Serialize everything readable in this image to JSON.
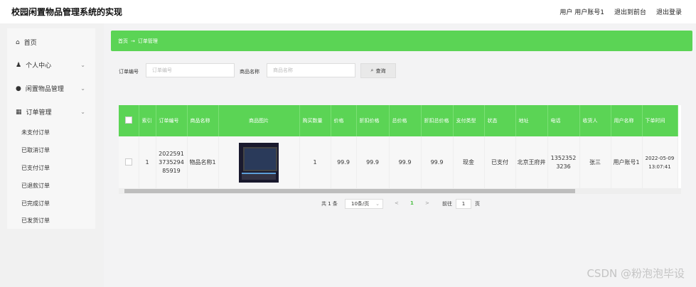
{
  "header": {
    "app_title": "校园闲置物品管理系统的实现",
    "user_label": "用户 用户账号1",
    "back_front": "退出到前台",
    "logout": "退出登录"
  },
  "sidebar": {
    "home": "首页",
    "personal_center": "个人中心",
    "idle_goods": "闲置物品管理",
    "order_mgmt": "订单管理",
    "sub_items": [
      "未支付订单",
      "已取消订单",
      "已支付订单",
      "已退款订单",
      "已完成订单",
      "已发货订单"
    ]
  },
  "breadcrumb": {
    "home": "首页",
    "arrow": "→",
    "current": "订单管理"
  },
  "search": {
    "order_no_label": "订单编号",
    "order_no_placeholder": "订单编号",
    "goods_name_label": "商品名称",
    "goods_name_placeholder": "商品名称",
    "query_button": "查询"
  },
  "table": {
    "headers": [
      "索引",
      "订单编号",
      "商品名称",
      "商品图片",
      "购买数量",
      "价格",
      "折扣价格",
      "总价格",
      "折扣总价格",
      "支付类型",
      "状态",
      "地址",
      "电话",
      "收货人",
      "用户名称",
      "下单时间"
    ],
    "rows": [
      {
        "index": "1",
        "order_no": "2022591373529485919",
        "goods_name": "物品名称1",
        "quantity": "1",
        "price": "99.9",
        "discount_price": "99.9",
        "total": "99.9",
        "discount_total": "99.9",
        "pay_type": "现金",
        "status": "已支付",
        "address": "北京王府井",
        "phone": "13523523236",
        "receiver": "张三",
        "user_name": "用户账号1",
        "order_time": "2022-05-09 13:07:41"
      }
    ]
  },
  "pagination": {
    "total": "共 1 条",
    "page_size": "10条/页",
    "prev": "<",
    "current_page": "1",
    "next": ">",
    "goto_label": "前往",
    "goto_value": "1",
    "page_unit": "页"
  },
  "watermark": "CSDN @粉泡泡毕设",
  "colors": {
    "accent": "#5bd455"
  }
}
